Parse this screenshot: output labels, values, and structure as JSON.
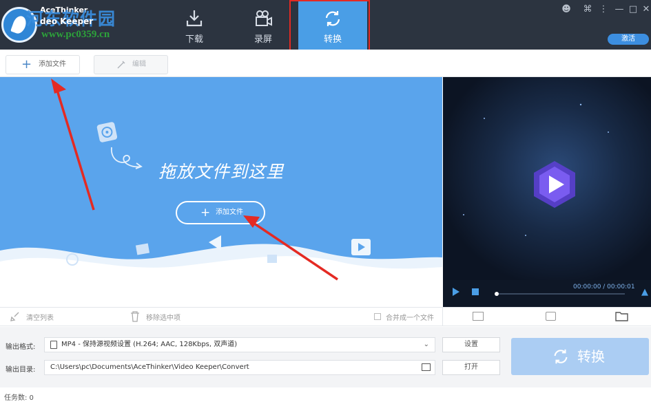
{
  "header": {
    "brand_top": "AceThinker",
    "brand_app": "deo Keeper",
    "watermark_cn": "河东软件园",
    "watermark_url": "www.pc0359.cn",
    "tabs": [
      {
        "label": "下载",
        "icon": "download-icon"
      },
      {
        "label": "录屏",
        "icon": "record-icon"
      },
      {
        "label": "转换",
        "icon": "convert-icon"
      }
    ],
    "activate_label": "激活",
    "accent": "#4a9ee6"
  },
  "toolbar": {
    "add_file": "添加文件",
    "edit": "编辑"
  },
  "drop": {
    "hint": "拖放文件到这里",
    "add_file": "添加文件"
  },
  "preview": {
    "time": "00:00:00 / 00:00:01"
  },
  "list": {
    "clear": "清空列表",
    "remove_selected": "移除选中项",
    "merge": "合并成一个文件"
  },
  "settings": {
    "format_label": "输出格式:",
    "format_value": "MP4 - 保持源视频设置 (H.264; AAC, 128Kbps, 双声道)",
    "dir_label": "输出目录:",
    "dir_value": "C:\\Users\\pc\\Documents\\AceThinker\\Video Keeper\\Convert",
    "settings_btn": "设置",
    "open_btn": "打开",
    "convert_btn": "转换"
  },
  "status": {
    "tasks": "任务数: 0"
  }
}
